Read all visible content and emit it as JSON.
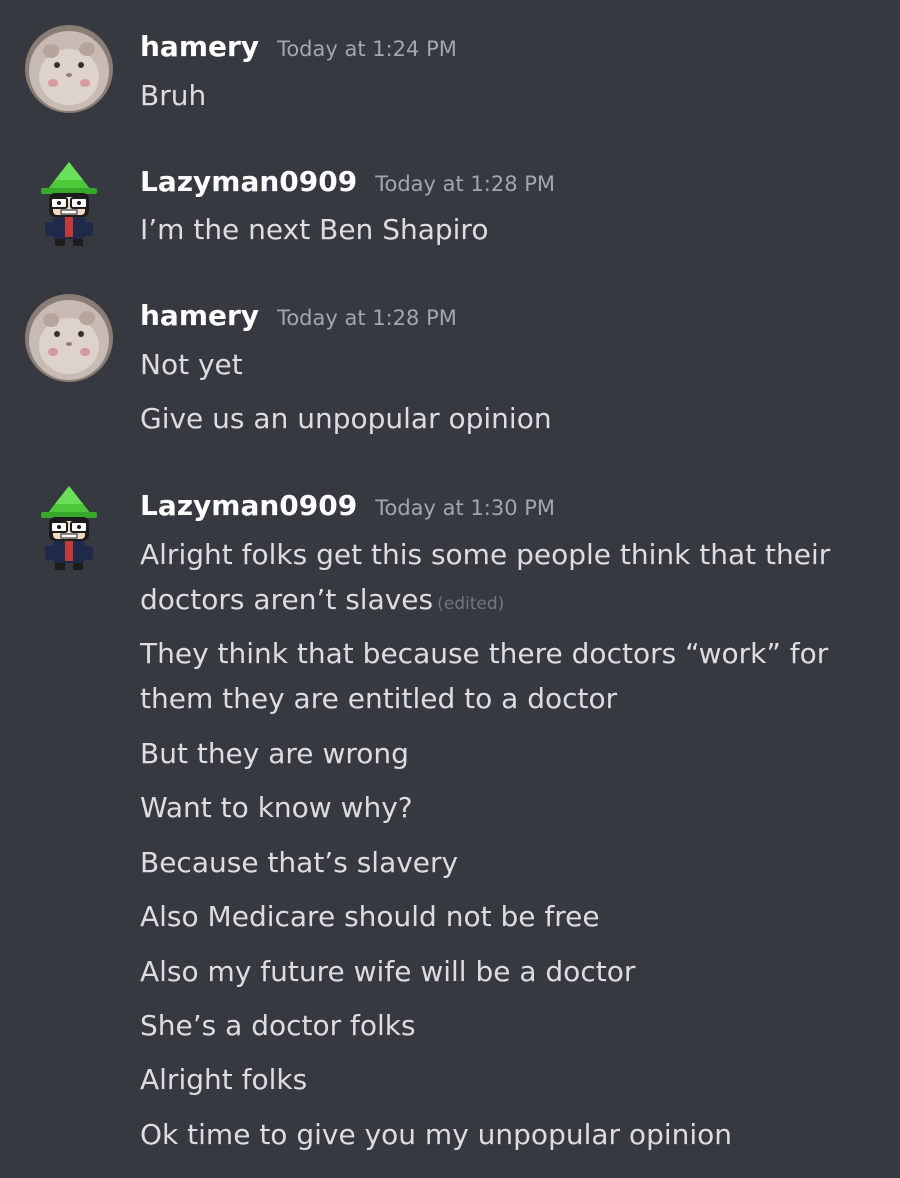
{
  "messages": [
    {
      "username": "hamery",
      "timestamp": "Today at 1:24 PM",
      "avatar": "hamster-avatar",
      "lines": [
        "Bruh"
      ]
    },
    {
      "username": "Lazyman0909",
      "timestamp": "Today at 1:28 PM",
      "avatar": "green-hat-avatar",
      "lines": [
        "I’m the next Ben Shapiro"
      ]
    },
    {
      "username": "hamery",
      "timestamp": "Today at 1:28 PM",
      "avatar": "hamster-avatar",
      "lines": [
        "Not yet",
        "Give us an unpopular opinion"
      ]
    },
    {
      "username": "Lazyman0909",
      "timestamp": "Today at 1:30 PM",
      "avatar": "green-hat-avatar",
      "lines": [
        "Alright folks get this some people think that their doctors aren’t slaves",
        "They think that because there doctors “work” for them they are entitled to a doctor",
        "But they are wrong",
        "Want to know why?",
        "Because that’s slavery",
        "Also Medicare should not be free",
        "Also my future wife will be a doctor",
        "She’s a doctor folks",
        "Alright folks",
        "Ok time to give you my unpopular opinion"
      ],
      "edited_label": "(edited)"
    }
  ],
  "colors": {
    "background": "#36393f",
    "username": "#ffffff",
    "timestamp": "#a3a6aa",
    "message_text": "#dcddde",
    "edited": "#72767d"
  }
}
